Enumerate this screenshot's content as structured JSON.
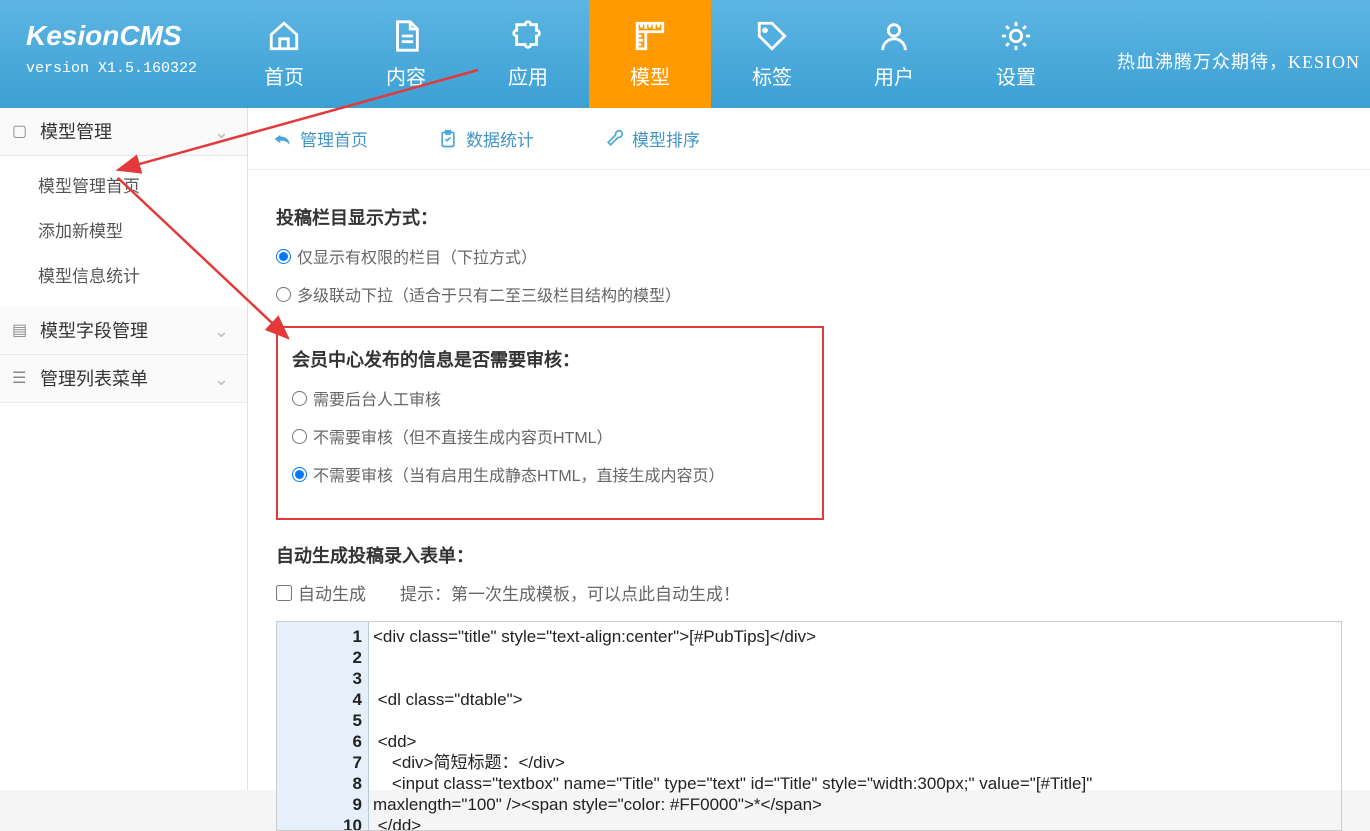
{
  "logo": {
    "title": "KesionCMS",
    "version": "version X1.5.160322"
  },
  "top_right": "热血沸腾万众期待，KESION",
  "nav": [
    {
      "label": "首页",
      "icon": "home"
    },
    {
      "label": "内容",
      "icon": "doc"
    },
    {
      "label": "应用",
      "icon": "puzzle"
    },
    {
      "label": "模型",
      "icon": "ruler"
    },
    {
      "label": "标签",
      "icon": "tag"
    },
    {
      "label": "用户",
      "icon": "user"
    },
    {
      "label": "设置",
      "icon": "gear"
    }
  ],
  "sidebar": {
    "groups": [
      {
        "label": "模型管理",
        "items": [
          "模型管理首页",
          "添加新模型",
          "模型信息统计"
        ]
      },
      {
        "label": "模型字段管理",
        "items": []
      },
      {
        "label": "管理列表菜单",
        "items": []
      }
    ]
  },
  "subnav": [
    {
      "label": "管理首页",
      "color": "#4aa6d6"
    },
    {
      "label": "数据统计",
      "color": "#4aa6d6"
    },
    {
      "label": "模型排序",
      "color": "#4aa6d6"
    }
  ],
  "form": {
    "section1_title": "投稿栏目显示方式：",
    "section1_options": [
      "仅显示有权限的栏目（下拉方式）",
      "多级联动下拉（适合于只有二至三级栏目结构的模型）"
    ],
    "section2_title": "会员中心发布的信息是否需要审核：",
    "section2_options": [
      "需要后台人工审核",
      "不需要审核（但不直接生成内容页HTML）",
      "不需要审核（当有启用生成静态HTML，直接生成内容页）"
    ],
    "section3_title": "自动生成投稿录入表单：",
    "section3_checkbox": "自动生成",
    "section3_hint": "提示：第一次生成模板，可以点此自动生成！",
    "code_lines": [
      "<div class=\"title\" style=\"text-align:center\">[#PubTips]</div>",
      "",
      "",
      " <dl class=\"dtable\">",
      "",
      " <dd>",
      "    <div>简短标题：</div>",
      "    <input class=\"textbox\" name=\"Title\" type=\"text\" id=\"Title\" style=\"width:300px;\" value=\"[#Title]\"",
      "maxlength=\"100\" /><span style=\"color: #FF0000\">*</span>",
      " </dd>"
    ]
  }
}
